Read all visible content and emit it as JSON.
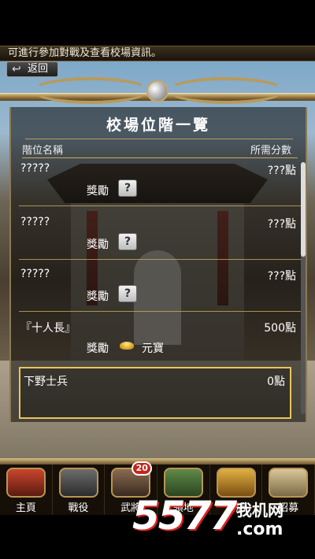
{
  "notice": {
    "text": "可進行參加對戰及查看校場資訊。"
  },
  "back_button": {
    "label": "返回"
  },
  "panel": {
    "title": "校場位階一覽",
    "header_name": "階位名稱",
    "header_score": "所需分數"
  },
  "ranks": [
    {
      "name": "?????",
      "points": "???點",
      "reward_label": "獎勵",
      "reward_icon": "?",
      "reward_text": ""
    },
    {
      "name": "?????",
      "points": "???點",
      "reward_label": "獎勵",
      "reward_icon": "?",
      "reward_text": ""
    },
    {
      "name": "?????",
      "points": "???點",
      "reward_label": "獎勵",
      "reward_icon": "?",
      "reward_text": ""
    },
    {
      "name": "『十人長』",
      "points": "500點",
      "reward_label": "獎勵",
      "reward_icon": "gold-ingot-icon",
      "reward_text": "元寶"
    }
  ],
  "current_rank": {
    "name": "下野士兵",
    "points": "0點"
  },
  "nav": [
    {
      "label": "主頁",
      "icon": "home-icon"
    },
    {
      "label": "戰役",
      "icon": "swords-icon"
    },
    {
      "label": "武將",
      "icon": "general-icon",
      "badge": "20"
    },
    {
      "label": "領地",
      "icon": "territory-icon"
    },
    {
      "label": "商店",
      "icon": "shop-icon"
    },
    {
      "label": "招募",
      "icon": "recruit-icon"
    }
  ],
  "watermark": {
    "number": "5577",
    "cn": "我机网",
    "com": ".com"
  },
  "colors": {
    "gold_border": "#e8c65a",
    "badge_red": "#c4261b"
  }
}
